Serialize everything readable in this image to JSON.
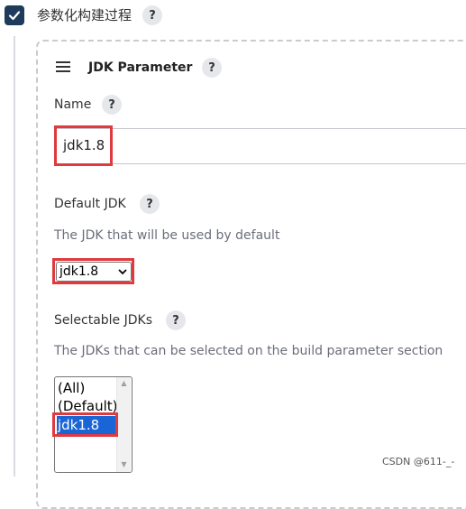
{
  "header": {
    "checkbox_label": "参数化构建过程",
    "help": "?"
  },
  "parameter": {
    "title": "JDK Parameter",
    "help": "?",
    "name": {
      "label": "Name",
      "help": "?",
      "value": "jdk1.8"
    },
    "default_jdk": {
      "label": "Default JDK",
      "help": "?",
      "description": "The JDK that will be used by default",
      "selected": "jdk1.8"
    },
    "selectable_jdks": {
      "label": "Selectable JDKs",
      "help": "?",
      "description": "The JDKs that can be selected on the build parameter section",
      "options": [
        {
          "label": "(All)",
          "selected": false
        },
        {
          "label": "(Default)",
          "selected": false
        },
        {
          "label": "jdk1.8",
          "selected": true
        }
      ]
    }
  },
  "watermark": "CSDN @611-_-",
  "colors": {
    "checkbox_bg": "#1f3b5c",
    "highlight": "#e0393e",
    "selection": "#1a65d6"
  },
  "icons": {
    "checkbox": "check-icon",
    "drag": "drag-handle-icon",
    "help": "help-icon",
    "dropdown": "chevron-down-icon"
  }
}
